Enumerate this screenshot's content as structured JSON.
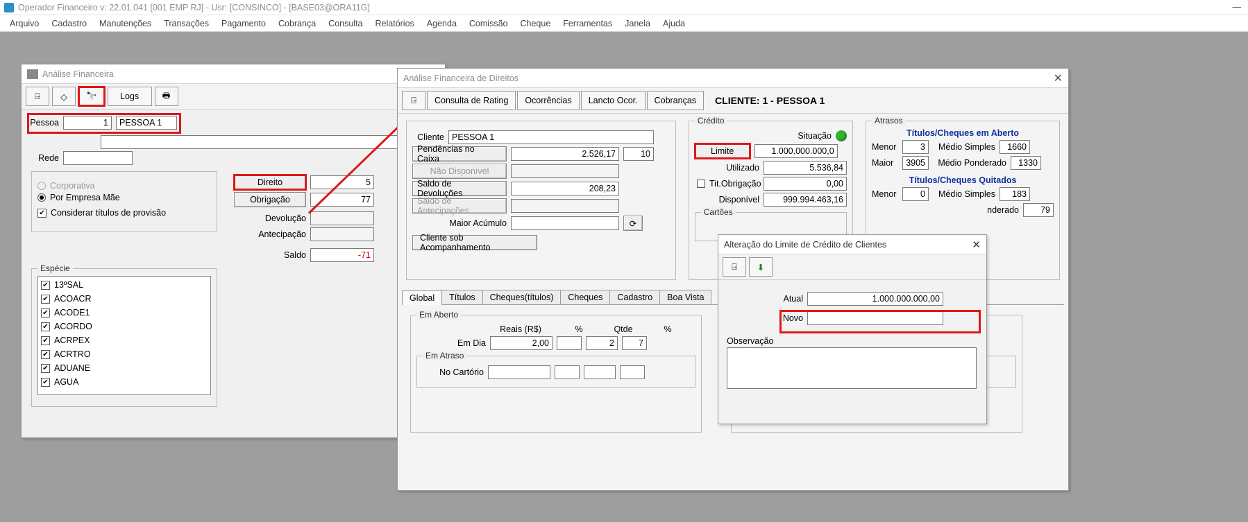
{
  "app_title": "Operador Financeiro  v: 22.01.041   [001 EMP RJ] - Usr: [CONSINCO] - [BASE03@ORA11G]",
  "menus": [
    "Arquivo",
    "Cadastro",
    "Manutenções",
    "Transações",
    "Pagamento",
    "Cobrança",
    "Consulta",
    "Relatórios",
    "Agenda",
    "Comissão",
    "Cheque",
    "Ferramentas",
    "Janela",
    "Ajuda"
  ],
  "win1": {
    "title": "Análise Financeira",
    "logs_btn": "Logs",
    "pessoa_label": "Pessoa",
    "pessoa_id": "1",
    "pessoa_name": "PESSOA 1",
    "rede_label": "Rede",
    "corporativa": "Corporativa",
    "por_empresa_mae": "Por Empresa Mãe",
    "considerar": "Considerar títulos de provisão",
    "direito_btn": "Direito",
    "direito_val": "5",
    "obrig_btn": "Obrigação",
    "obrig_val": "77",
    "devolucao_lbl": "Devolução",
    "antecip_lbl": "Antecipação",
    "saldo_lbl": "Saldo",
    "saldo_val": "-71",
    "especie_legend": "Espécie",
    "especies": [
      "13ºSAL",
      "ACOACR",
      "ACODE1",
      "ACORDO",
      "ACRPEX",
      "ACRTRO",
      "ADUANE",
      "AGUA"
    ]
  },
  "win2": {
    "title": "Análise Financeira de Direitos",
    "tb_rating": "Consulta de Rating",
    "tb_ocorr": "Ocorrências",
    "tb_lancto": "Lancto Ocor.",
    "tb_cobr": "Cobranças",
    "cliente_header": "CLIENTE: 1 - PESSOA 1",
    "cliente_lbl": "Cliente",
    "cliente_val": "PESSOA 1",
    "pend_btn": "Pendências no Caixa",
    "pend_val": "2.526,17",
    "pend_qtd": "10",
    "naodisp_btn": "Não Disponível",
    "saldo_dev_btn": "Saldo de Devoluções",
    "saldo_dev_val": "208,23",
    "saldo_antec_btn": "Saldo de Antecipações",
    "maior_acumulo_lbl": "Maior Acúmulo",
    "cliente_acomp_btn": "Cliente sob Acompanhamento",
    "credito_legend": "Crédito",
    "situacao_lbl": "Situação",
    "limite_btn": "Limite",
    "limite_val": "1.000.000.000,0",
    "utilizado_lbl": "Utilizado",
    "utilizado_val": "5.536,84",
    "titobrig_lbl": "Tit.Obrigação",
    "titobrig_val": "0,00",
    "disponivel_lbl": "Disponível",
    "disponivel_val": "999.994.463,16",
    "cartoes_lbl": "Cartões",
    "atrasos_legend": "Atrasos",
    "tc_aberto": "Títulos/Cheques em Aberto",
    "menor_lbl": "Menor",
    "maior_lbl": "Maior",
    "ms_lbl": "Médio Simples",
    "mp_lbl": "Médio Ponderado",
    "ab_menor": "3",
    "ab_ms": "1660",
    "ab_maior": "3905",
    "ab_mp": "1330",
    "tc_quitados": "Títulos/Cheques Quitados",
    "qt_menor": "0",
    "qt_ms": "183",
    "qt_mp": "79",
    "tabs": [
      "Global",
      "Títulos",
      "Cheques(títulos)",
      "Cheques",
      "Cadastro",
      "Boa Vista"
    ],
    "global_aberto": "Em Aberto",
    "hdr_reais": "Reais (R$)",
    "hdr_pct": "%",
    "hdr_qtde": "Qtde",
    "hdr_pct2": "%",
    "emdia_lbl": "Em Dia",
    "emdia_val": "2,00",
    "emdia_q": "2",
    "emdia_p": "7",
    "ematraso_legend": "Em Atraso",
    "no_cartorio": "No Cartório"
  },
  "dlg": {
    "title": "Alteração do Limite de Crédito de Clientes",
    "atual_lbl": "Atual",
    "atual_val": "1.000.000.000,00",
    "novo_lbl": "Novo",
    "observ_lbl": "Observação"
  }
}
